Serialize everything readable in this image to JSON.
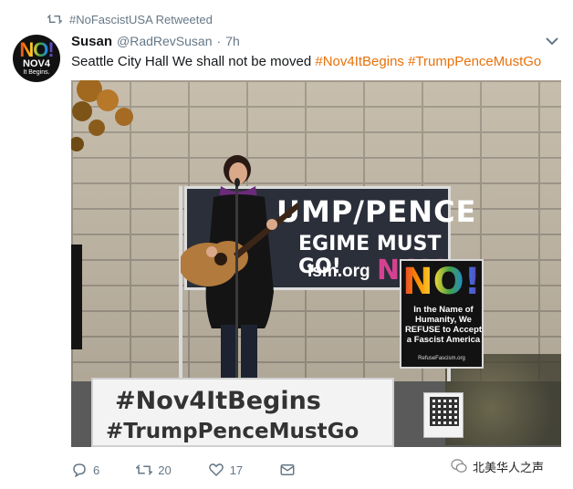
{
  "retweet": {
    "text": "#NoFascistUSA Retweeted"
  },
  "avatar": {
    "line1": "NO!",
    "line2": "NOV4",
    "line3": "It Begins."
  },
  "author": {
    "name": "Susan",
    "handle": "@RadRevSusan",
    "separator": "·",
    "time": "7h"
  },
  "tweet": {
    "text": "Seattle City Hall  We shall not be moved",
    "hashtags": [
      "#Nov4ItBegins",
      "#TrumpPenceMustGo"
    ]
  },
  "photo": {
    "banner_line1": "UMP/PENCE",
    "banner_line2": "EGIME MUST GO!",
    "banner_line3": "ism.org",
    "banner_line4": "NOV4",
    "no_sign_title": "NO!",
    "no_sign_text": "In the Name of Humanity, We REFUSE to Accept a Fascist America",
    "no_sign_url": "RefuseFascism.org",
    "bottom_line1": "#Nov4ItBegins",
    "bottom_line2": "#TrumpPenceMustGo"
  },
  "actions": {
    "replies": "6",
    "retweets": "20",
    "likes": "17"
  },
  "watermark": {
    "text": "北美华人之声"
  },
  "colors": {
    "hashtag": "#e8710a",
    "muted": "#657786",
    "text": "#14171a"
  }
}
